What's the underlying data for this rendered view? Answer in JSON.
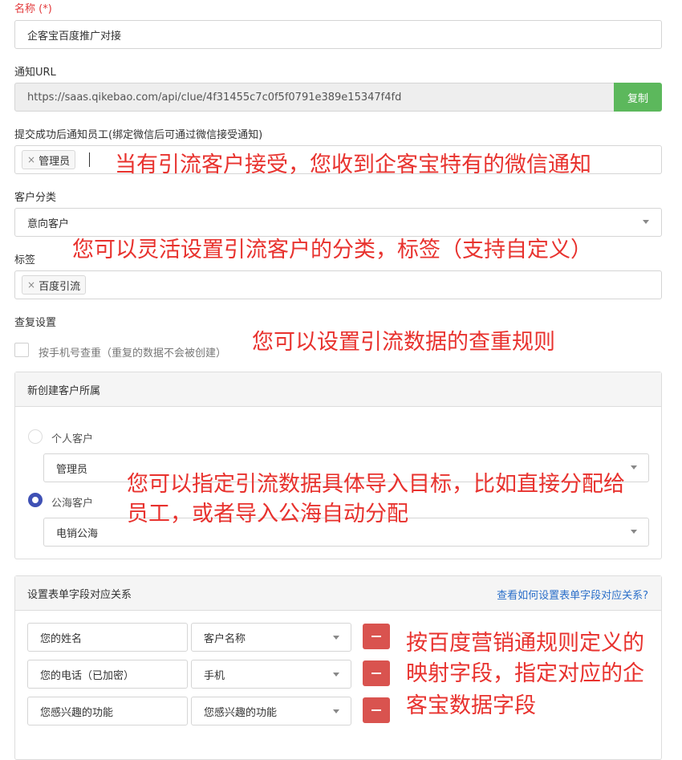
{
  "form": {
    "name": {
      "label": "名称",
      "required_mark": "(*)",
      "value": "企客宝百度推广对接"
    },
    "notify_url": {
      "label": "通知URL",
      "value": "https://saas.qikebao.com/api/clue/4f31455c7c0f5f0791e389e15347f4fd",
      "copy_label": "复制"
    },
    "notify_staff": {
      "label": "提交成功后通知员工(绑定微信后可通过微信接受通知)",
      "tags": [
        "管理员"
      ]
    },
    "customer_category": {
      "label": "客户分类",
      "value": "意向客户"
    },
    "tags": {
      "label": "标签",
      "tags": [
        "百度引流"
      ]
    },
    "dedupe": {
      "label": "查复设置",
      "checkbox_label": "按手机号查重（重复的数据不会被创建）",
      "checked": false
    },
    "owner_panel": {
      "title": "新创建客户所属",
      "personal": {
        "label": "个人客户",
        "selected": false,
        "select_value": "管理员"
      },
      "public": {
        "label": "公海客户",
        "selected": true,
        "select_value": "电销公海"
      }
    },
    "mapping_panel": {
      "title": "设置表单字段对应关系",
      "help_link": "查看如何设置表单字段对应关系?",
      "rows": [
        {
          "source": "您的姓名",
          "target": "客户名称"
        },
        {
          "source": "您的电话（已加密）",
          "target": "手机"
        },
        {
          "source": "您感兴趣的功能",
          "target": "您感兴趣的功能"
        }
      ]
    }
  },
  "annotations": {
    "notify": "当有引流客户接受，您收到企客宝特有的微信通知",
    "category": "您可以灵活设置引流客户的分类，标签（支持自定义）",
    "dedupe": "您可以设置引流数据的查重规则",
    "owner_line1": "您可以指定引流数据具体导入目标，比如直接分配给",
    "owner_line2": "员工，或者导入公海自动分配",
    "mapping_line1": "按百度营销通规则定义的",
    "mapping_line2": "映射字段，指定对应的企",
    "mapping_line3": "客宝数据字段"
  },
  "colors": {
    "annotation": "#e8322e",
    "copy_button": "#5cb85c",
    "delete_button": "#d9534f",
    "radio_selected": "#3f51b5",
    "link": "#2a6fc9"
  },
  "icons": {
    "tag_remove": "×",
    "dropdown": "chevron-down-icon",
    "delete": "minus-icon"
  }
}
